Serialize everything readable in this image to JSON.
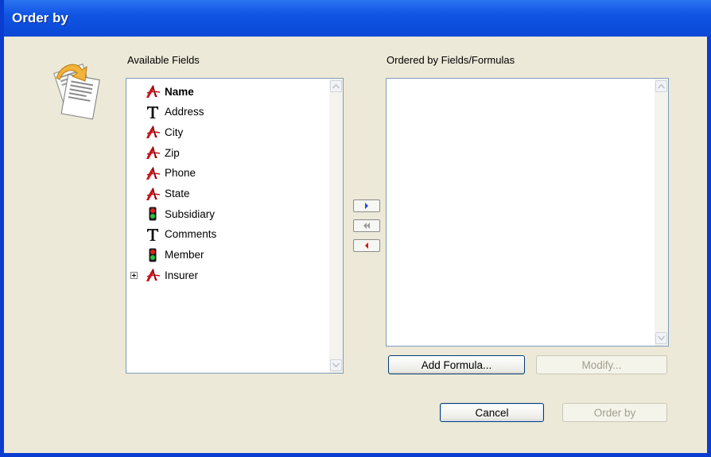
{
  "window": {
    "title": "Order by"
  },
  "available_fields": {
    "label": "Available Fields",
    "items": [
      {
        "label": "Name",
        "icon": "relation-a-icon",
        "bold": true,
        "expandable": false
      },
      {
        "label": "Address",
        "icon": "text-t-icon",
        "bold": false,
        "expandable": false
      },
      {
        "label": "City",
        "icon": "relation-a-icon",
        "bold": false,
        "expandable": false
      },
      {
        "label": "Zip",
        "icon": "relation-a-icon",
        "bold": false,
        "expandable": false
      },
      {
        "label": "Phone",
        "icon": "relation-a-icon",
        "bold": false,
        "expandable": false
      },
      {
        "label": "State",
        "icon": "relation-a-icon",
        "bold": false,
        "expandable": false
      },
      {
        "label": "Subsidiary",
        "icon": "boolean-trafficlight-icon",
        "bold": false,
        "expandable": false
      },
      {
        "label": "Comments",
        "icon": "text-t-icon",
        "bold": false,
        "expandable": false
      },
      {
        "label": "Member",
        "icon": "boolean-trafficlight-icon",
        "bold": false,
        "expandable": false
      },
      {
        "label": "Insurer",
        "icon": "relation-a-icon",
        "bold": false,
        "expandable": true
      }
    ]
  },
  "ordered_fields": {
    "label": "Ordered by Fields/Formulas",
    "items": []
  },
  "move_buttons": [
    {
      "name": "add-field-button",
      "icon": "arrow-right-blue-icon"
    },
    {
      "name": "remove-all-button",
      "icon": "double-arrow-left-gray-icon"
    },
    {
      "name": "remove-field-button",
      "icon": "arrow-left-red-icon"
    }
  ],
  "buttons": {
    "add_formula": "Add Formula...",
    "modify": "Modify...",
    "cancel": "Cancel",
    "order_by": "Order by"
  },
  "colors": {
    "titlebar": "#0b4fd9",
    "dialog_bg": "#ece9d8",
    "list_border": "#7f9db9"
  }
}
